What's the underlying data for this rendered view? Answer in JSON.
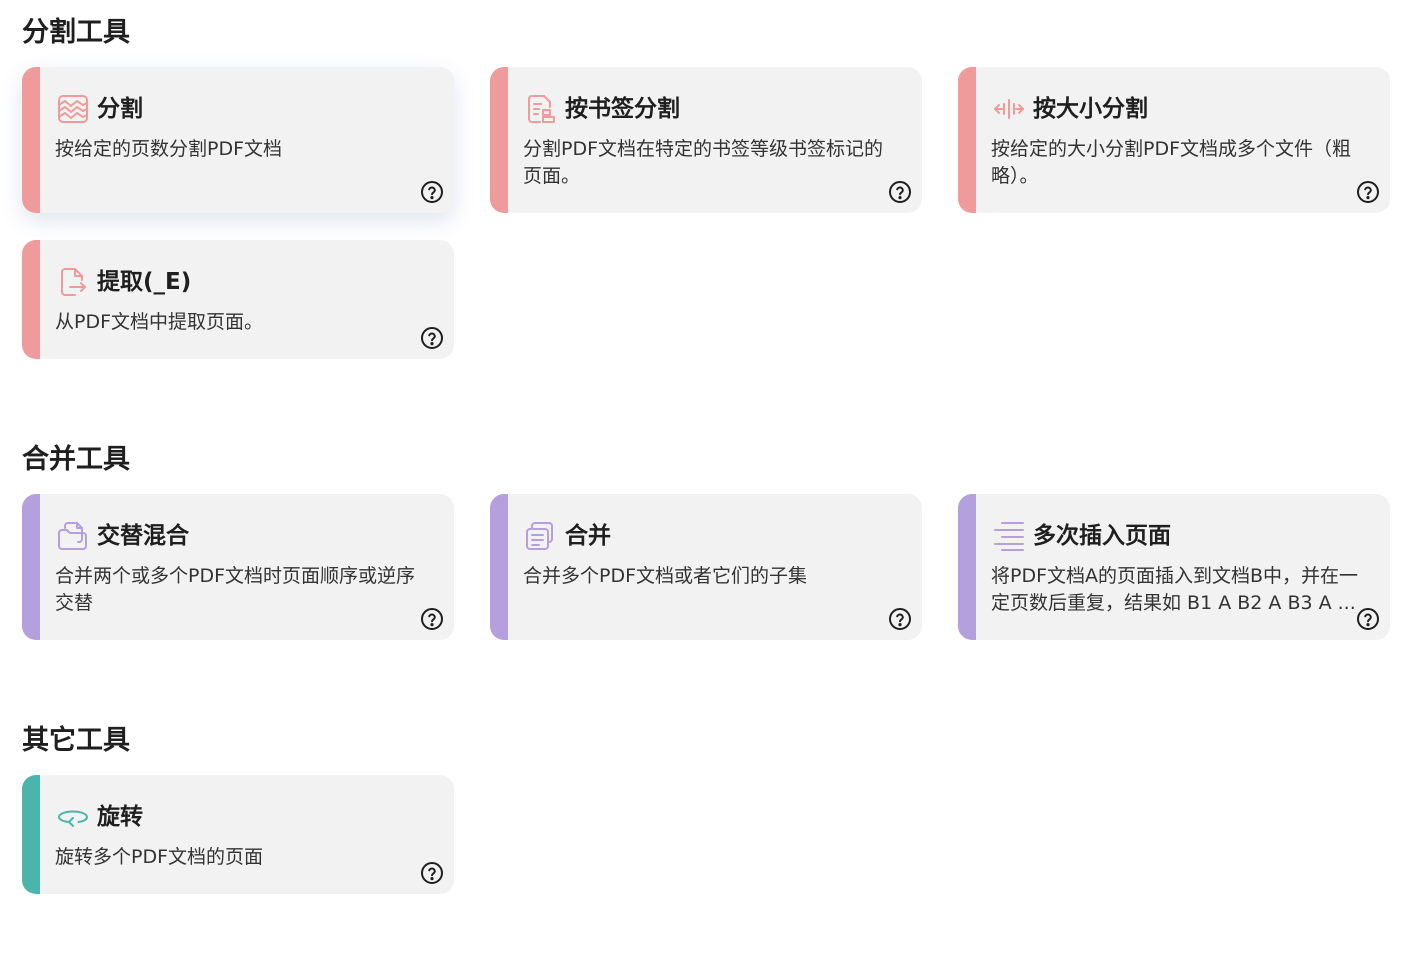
{
  "colors": {
    "split_accent": "#f09b9b",
    "merge_accent": "#b4a0dc",
    "other_accent": "#4cb5ab",
    "card_bg": "#f2f2f2"
  },
  "sections": {
    "split": {
      "title": "分割工具"
    },
    "merge": {
      "title": "合并工具"
    },
    "other": {
      "title": "其它工具"
    }
  },
  "split_cards": [
    {
      "icon": "split-pages-icon",
      "title": "分割",
      "desc": "按给定的页数分割PDF文档"
    },
    {
      "icon": "bookmark-split-icon",
      "title": "按书签分割",
      "desc": "分割PDF文档在特定的书签等级书签标记的页面。"
    },
    {
      "icon": "size-split-icon",
      "title": "按大小分割",
      "desc": "按给定的大小分割PDF文档成多个文件（粗略）。"
    },
    {
      "icon": "extract-icon",
      "title": "提取(_E)",
      "desc": "从PDF文档中提取页面。"
    }
  ],
  "merge_cards": [
    {
      "icon": "alternate-mix-icon",
      "title": "交替混合",
      "desc": "合并两个或多个PDF文档时页面顺序或逆序交替"
    },
    {
      "icon": "merge-icon",
      "title": "合并",
      "desc": "合并多个PDF文档或者它们的子集"
    },
    {
      "icon": "multi-insert-icon",
      "title": "多次插入页面",
      "desc": "将PDF文档A的页面插入到文档B中，并在一定页数后重复，结果如 B1 A B2 A B3 A ..."
    }
  ],
  "other_cards": [
    {
      "icon": "rotate-icon",
      "title": "旋转",
      "desc": "旋转多个PDF文档的页面"
    }
  ],
  "help_icon": "help-circle-icon"
}
